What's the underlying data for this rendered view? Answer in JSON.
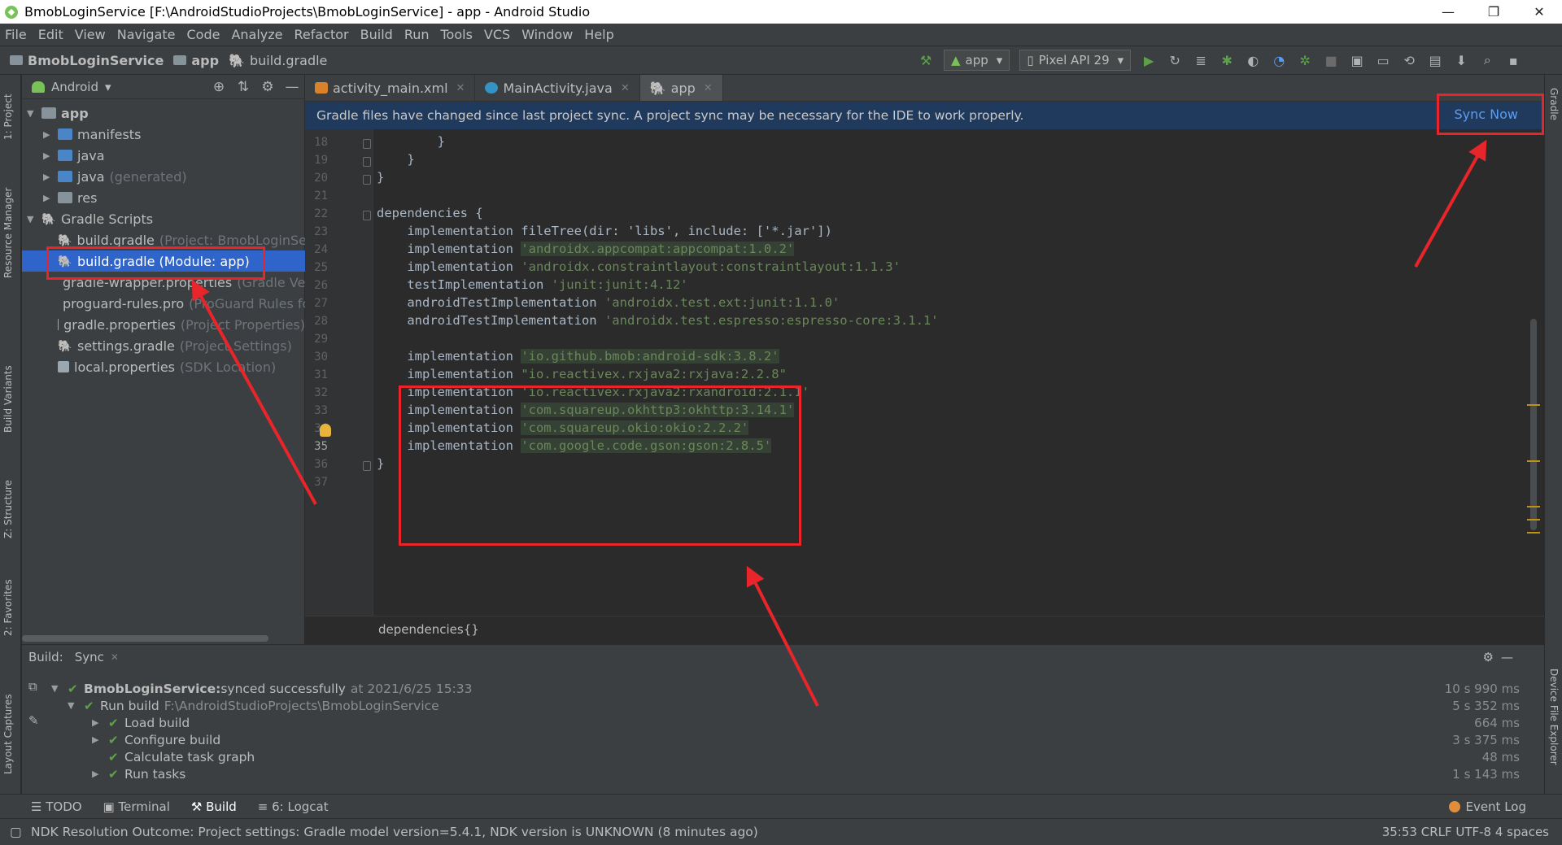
{
  "window": {
    "title": "BmobLoginService [F:\\AndroidStudioProjects\\BmobLoginService] - app - Android Studio",
    "controls": [
      "—",
      "❐",
      "✕"
    ]
  },
  "menu": [
    "File",
    "Edit",
    "View",
    "Navigate",
    "Code",
    "Analyze",
    "Refactor",
    "Build",
    "Run",
    "Tools",
    "VCS",
    "Window",
    "Help"
  ],
  "breadcrumb": [
    "BmobLoginService",
    "app",
    "build.gradle"
  ],
  "toolbar": {
    "config": "app",
    "device": "Pixel API 29"
  },
  "left_strip": [
    "1: Project",
    "Resource Manager",
    "Build Variants",
    "Z: Structure",
    "2: Favorites",
    "Layout Captures"
  ],
  "right_strip": [
    "Gradle",
    "Device File Explorer"
  ],
  "project": {
    "view": "Android",
    "tree": [
      {
        "label": "app",
        "hint": ""
      },
      {
        "label": "manifests",
        "hint": ""
      },
      {
        "label": "java",
        "hint": ""
      },
      {
        "label": "java",
        "hint": "(generated)"
      },
      {
        "label": "res",
        "hint": ""
      },
      {
        "label": "Gradle Scripts",
        "hint": ""
      },
      {
        "label": "build.gradle",
        "hint": "(Project: BmobLoginServi"
      },
      {
        "label": "build.gradle (Module: app)",
        "hint": ""
      },
      {
        "label": "gradle-wrapper.properties",
        "hint": "(Gradle Ve"
      },
      {
        "label": "proguard-rules.pro",
        "hint": "(ProGuard Rules fc"
      },
      {
        "label": "gradle.properties",
        "hint": "(Project Properties)"
      },
      {
        "label": "settings.gradle",
        "hint": "(Project Settings)"
      },
      {
        "label": "local.properties",
        "hint": "(SDK Location)"
      }
    ]
  },
  "editor": {
    "tabs": [
      "activity_main.xml",
      "MainActivity.java",
      "app"
    ],
    "banner": "Gradle files have changed since last project sync. A project sync may be necessary for the IDE to work properly.",
    "sync_now": "Sync Now",
    "line_numbers": [
      "18",
      "19",
      "20",
      "21",
      "22",
      "23",
      "24",
      "25",
      "26",
      "27",
      "28",
      "29",
      "30",
      "31",
      "32",
      "33",
      "34",
      "35",
      "36",
      "37"
    ],
    "lines": [
      {
        "kw": "        }",
        "str": ""
      },
      {
        "kw": "    }",
        "str": ""
      },
      {
        "kw": "}",
        "str": ""
      },
      {
        "kw": "",
        "str": ""
      },
      {
        "kw": "dependencies {",
        "str": ""
      },
      {
        "kw": "    implementation fileTree(dir: 'libs', include: ['*.jar'])",
        "str": ""
      },
      {
        "kw": "    implementation ",
        "str": "'androidx.appcompat:appcompat:1.0.2'"
      },
      {
        "kw": "    implementation ",
        "str": "'androidx.constraintlayout:constraintlayout:1.1.3'"
      },
      {
        "kw": "    testImplementation ",
        "str": "'junit:junit:4.12'"
      },
      {
        "kw": "    androidTestImplementation ",
        "str": "'androidx.test.ext:junit:1.1.0'"
      },
      {
        "kw": "    androidTestImplementation ",
        "str": "'androidx.test.espresso:espresso-core:3.1.1'"
      },
      {
        "kw": "",
        "str": ""
      },
      {
        "kw": "    implementation ",
        "str": "'io.github.bmob:android-sdk:3.8.2'"
      },
      {
        "kw": "    implementation ",
        "str": "\"io.reactivex.rxjava2:rxjava:2.2.8\""
      },
      {
        "kw": "    implementation ",
        "str": "'io.reactivex.rxjava2:rxandroid:2.1.1'"
      },
      {
        "kw": "    implementation ",
        "str": "'com.squareup.okhttp3:okhttp:3.14.1'"
      },
      {
        "kw": "    implementation ",
        "str": "'com.squareup.okio:okio:2.2.2'"
      },
      {
        "kw": "    implementation ",
        "str": "'com.google.code.gson:gson:2.8.5'"
      },
      {
        "kw": "}",
        "str": ""
      },
      {
        "kw": "",
        "str": ""
      }
    ],
    "footer_crumb": "dependencies{}"
  },
  "build": {
    "label": "Build:",
    "tab": "Sync",
    "rows": [
      {
        "bold": "BmobLoginService:",
        "text": " synced successfully",
        "dim": "at 2021/6/25 15:33",
        "time": "10 s 990 ms"
      },
      {
        "bold": "",
        "text": "Run build",
        "dim": "F:\\AndroidStudioProjects\\BmobLoginService",
        "time": "5 s 352 ms"
      },
      {
        "bold": "",
        "text": "Load build",
        "dim": "",
        "time": "664 ms"
      },
      {
        "bold": "",
        "text": "Configure build",
        "dim": "",
        "time": "3 s 375 ms"
      },
      {
        "bold": "",
        "text": "Calculate task graph",
        "dim": "",
        "time": "48 ms"
      },
      {
        "bold": "",
        "text": "Run tasks",
        "dim": "",
        "time": "1 s 143 ms"
      }
    ]
  },
  "bottom_tabs": [
    "TODO",
    "Terminal",
    "Build",
    "6: Logcat"
  ],
  "event_log": "Event Log",
  "status": {
    "message": "NDK Resolution Outcome: Project settings: Gradle model version=5.4.1, NDK version is UNKNOWN (8 minutes ago)",
    "right": "35:53  CRLF  UTF-8  4 spaces"
  },
  "colors": {
    "highlight": "#e8252a",
    "banner": "#1f3a5c",
    "selection": "#2f65ca",
    "string": "#6a8759"
  }
}
